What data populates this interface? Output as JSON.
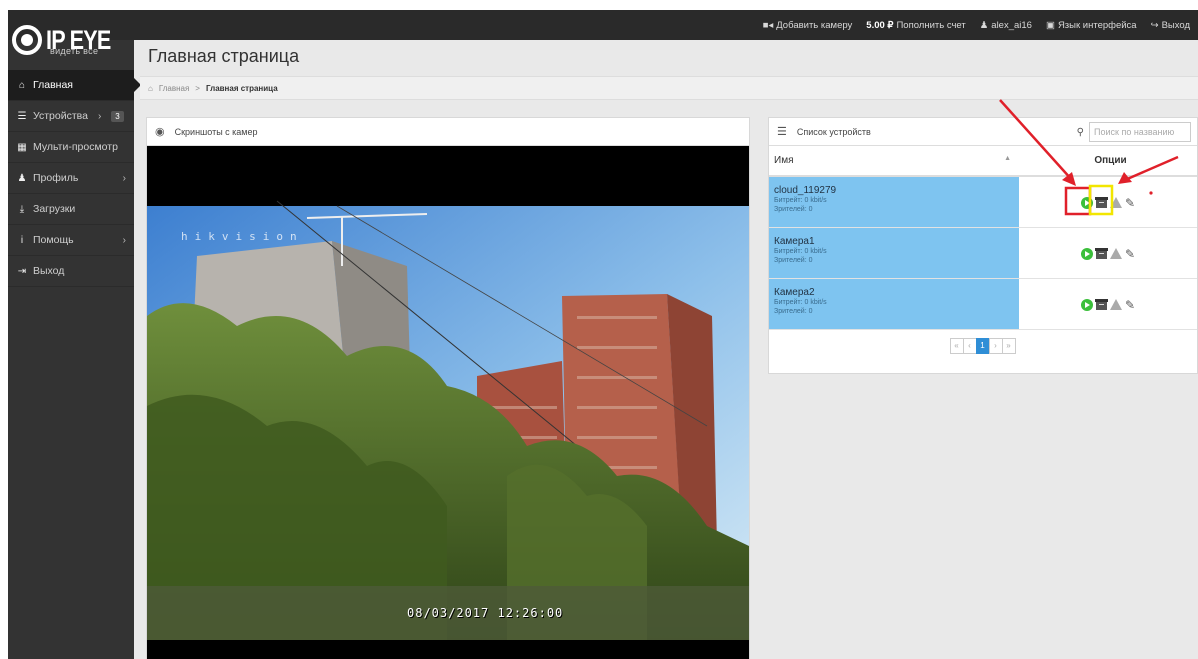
{
  "header": {
    "logo_text": "IP EYE",
    "logo_slogan": "видеть все",
    "nav": {
      "add_camera": "Добавить камеру",
      "balance": "5.00 ₽",
      "top_up": "Пополнить счет",
      "username": "alex_ai16",
      "language": "Язык интерфейса",
      "logout": "Выход"
    }
  },
  "sidebar": {
    "items": [
      {
        "label": "Главная",
        "icon": "home-icon"
      },
      {
        "label": "Устройства",
        "icon": "list-icon",
        "badge": "3"
      },
      {
        "label": "Мульти-просмотр",
        "icon": "grid-icon"
      },
      {
        "label": "Профиль",
        "icon": "user-icon"
      },
      {
        "label": "Загрузки",
        "icon": "download-icon"
      },
      {
        "label": "Помощь",
        "icon": "info-icon"
      },
      {
        "label": "Выход",
        "icon": "logout-icon"
      }
    ]
  },
  "page": {
    "title": "Главная страница",
    "breadcrumb": {
      "root": "Главная",
      "current": "Главная страница"
    }
  },
  "screenshots": {
    "title": "Скриншоты с камер",
    "timestamp": "08/03/2017 12:26:00",
    "watermark": "hikvision"
  },
  "devices": {
    "title": "Список устройств",
    "search_placeholder": "Поиск по названию",
    "columns": {
      "name": "Имя",
      "options": "Опции"
    },
    "rows": [
      {
        "name": "cloud_119279",
        "bitrate": "Битрейт: 0 kbit/s",
        "viewers": "Зрителей: 0"
      },
      {
        "name": "Камера1",
        "bitrate": "Битрейт: 0 kbit/s",
        "viewers": "Зрителей: 0"
      },
      {
        "name": "Камера2",
        "bitrate": "Битрейт: 0 kbit/s",
        "viewers": "Зрителей: 0"
      }
    ],
    "pager": {
      "first": "«",
      "prev": "‹",
      "current": "1",
      "next": "›",
      "last": "»"
    }
  },
  "colors": {
    "row_highlight": "#7ec4f0",
    "annotation_red": "#e0202a",
    "annotation_yellow": "#f2e600",
    "play_green": "#3bbf3b"
  }
}
